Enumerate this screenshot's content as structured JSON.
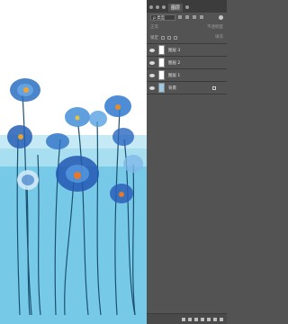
{
  "panel": {
    "tabs": [
      "图层"
    ],
    "filter_label": "ρ 类型",
    "blend_mode": "正常",
    "opacity_label": "不透明度",
    "lock_label": "锁定",
    "fill_label": "填充",
    "layers": [
      {
        "name": "图层 3",
        "visible": true
      },
      {
        "name": "图层 2",
        "visible": true
      },
      {
        "name": "图层 1",
        "visible": true
      },
      {
        "name": "背景",
        "visible": true,
        "locked": true
      }
    ]
  },
  "colors": {
    "panel_bg": "#535353",
    "canvas_bg": "#ffffff",
    "flower_blue": "#2a6fc2",
    "water_cyan": "#49b8dd"
  }
}
